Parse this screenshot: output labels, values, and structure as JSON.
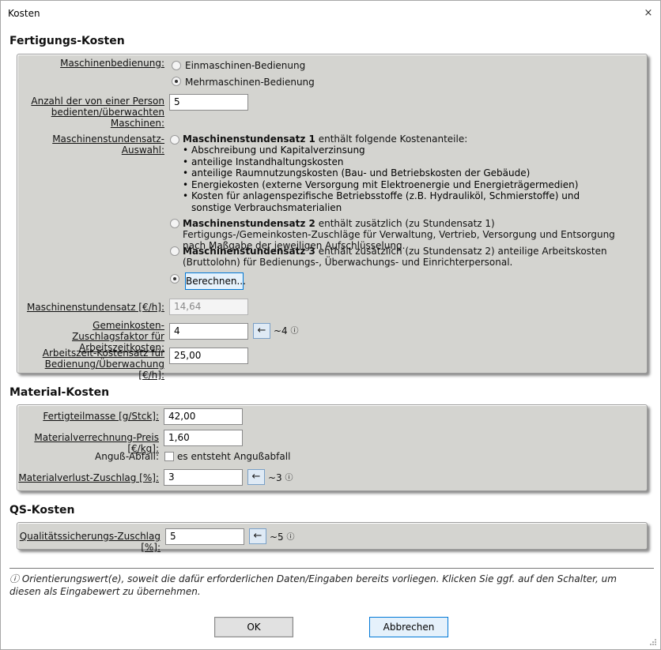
{
  "window": {
    "title": "Kosten",
    "close_glyph": "×"
  },
  "sections": {
    "fertigung": "Fertigungs-Kosten",
    "material": "Material-Kosten",
    "qs": "QS-Kosten"
  },
  "fertigung": {
    "maschinenbedienung_label": "Maschinenbedienung:",
    "option_einmaschinen": "Einmaschinen-Bedienung",
    "option_mehrmaschinen": "Mehrmaschinen-Bedienung",
    "anzahl_label": "Anzahl der von einer Person bedienten/überwachten Maschinen:",
    "anzahl_value": "5",
    "auswahl_label": "Maschinenstundensatz-Auswahl:",
    "msr1_bold": "Maschinenstundensatz 1",
    "msr1_text": " enthält folgende Kostenanteile:",
    "msr1_items": [
      "Abschreibung und Kapitalverzinsung",
      "anteilige Instandhaltungskosten",
      "anteilige Raumnutzungskosten (Bau- und Betriebskosten der Gebäude)",
      "Energiekosten (externe Versorgung mit Elektroenergie und Energieträgermedien)",
      "Kosten für anlagenspezifische Betriebsstoffe (z.B. Hydrauliköl, Schmierstoffe) und sonstige Verbrauchsmaterialien"
    ],
    "msr2_bold": "Maschinenstundensatz 2",
    "msr2_text": " enthält zusätzlich (zu Stundensatz 1) Fertigungs-/Gemeinkosten-Zuschläge für Verwaltung, Vertrieb, Versorgung und Entsorgung nach Maßgabe der jeweiligen Aufschlüsselung.",
    "msr3_bold": "Maschinenstundensatz 3",
    "msr3_text": " enthält zusätzlich (zu Stundensatz 2) anteilige Arbeitskosten (Bruttolohn) für Bedienungs-, Überwachungs- und Einrichterpersonal.",
    "berechnen_label": "Berechnen...",
    "stundensatz_label": "Maschinenstundensatz [€/h]:",
    "stundensatz_value": "14,64",
    "gemeinkosten_label": "Gemeinkosten-Zuschlagsfaktor für Arbeitszeitkosten:",
    "gemeinkosten_value": "4",
    "gemeinkosten_hint": "~4",
    "arbeitszeit_label": "Arbeitszeit-Kostensatz für Bedienung/Überwachung [€/h]:",
    "arbeitszeit_value": "25,00"
  },
  "material": {
    "masse_label": "Fertigteilmasse [g/Stck]:",
    "masse_value": "42,00",
    "preis_label": "Materialverrechnung-Preis [€/kg]:",
    "preis_value": "1,60",
    "anguss_label": "Anguß-Abfall:",
    "anguss_checkbox_label": "es entsteht Angußabfall",
    "verlust_label": "Materialverlust-Zuschlag [%]:",
    "verlust_value": "3",
    "verlust_hint": "~3"
  },
  "qs": {
    "zuschlag_label": "Qualitätssicherungs-Zuschlag [%]:",
    "zuschlag_value": "5",
    "zuschlag_hint": "~5"
  },
  "footnote": "ⓘ Orientierungswert(e), soweit die dafür erforderlichen Daten/Eingaben bereits vorliegen. Klicken Sie ggf. auf den Schalter, um diesen als Eingabewert zu übernehmen.",
  "buttons": {
    "ok": "OK",
    "cancel": "Abbrechen"
  },
  "icons": {
    "info": "ⓘ",
    "arrow_left": "←"
  }
}
